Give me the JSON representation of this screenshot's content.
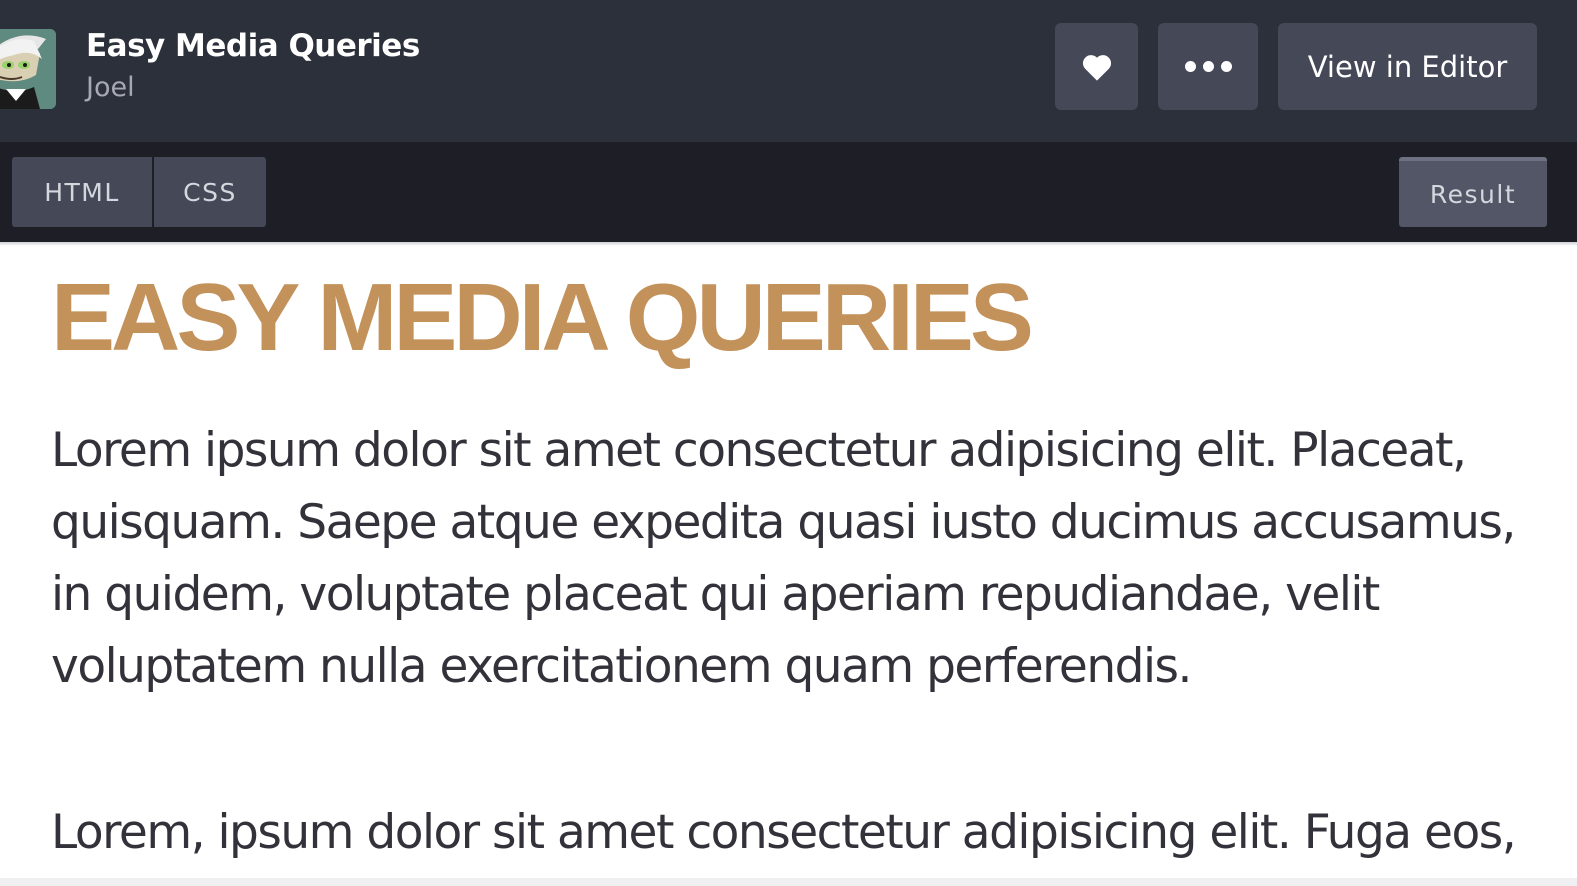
{
  "header": {
    "pen_title": "Easy Media Queries",
    "author": "Joel",
    "heart_icon": "heart-icon",
    "more_icon": "more-dots-icon",
    "view_in_editor_label": "View in Editor"
  },
  "tabs": {
    "html": "HTML",
    "css": "CSS",
    "result": "Result"
  },
  "result": {
    "heading": "EASY MEDIA QUERIES",
    "paragraphs": [
      "Lorem ipsum dolor sit amet consectetur adipisicing elit. Placeat, quisquam. Saepe atque expedita quasi iusto ducimus accusamus, in quidem, voluptate placeat qui aperiam repudiandae, velit voluptatem nulla exercitationem quam perferendis.",
      "Lorem, ipsum dolor sit amet consectetur adipisicing elit. Fuga eos,"
    ]
  },
  "colors": {
    "header_bg": "#2c303a",
    "tabbar_bg": "#1e1f26",
    "button_bg": "#444857",
    "heading_color": "#c3915a",
    "body_text": "#33323a"
  }
}
